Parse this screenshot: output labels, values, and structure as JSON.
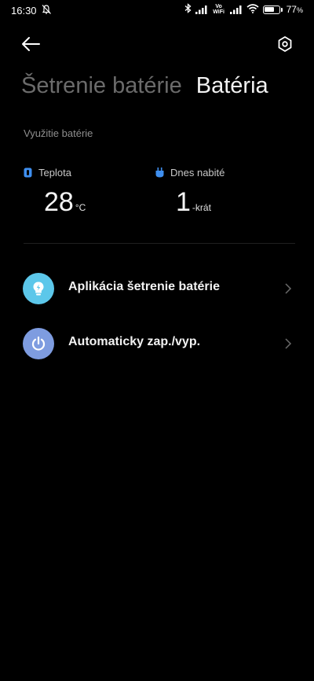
{
  "status_bar": {
    "time": "16:30",
    "volte_top": "Vo",
    "volte_bottom": "WiFi",
    "battery_percent": "77",
    "battery_unit": "%",
    "battery_level": 0.77
  },
  "tabs": [
    {
      "label": "Šetrenie batérie",
      "active": false
    },
    {
      "label": "Batéria",
      "active": true
    }
  ],
  "usage_section": {
    "label": "Využitie batérie"
  },
  "stats": {
    "temperature": {
      "label": "Teplota",
      "value": "28",
      "unit": "°C",
      "icon_color": "#3f8ff0"
    },
    "charged_today": {
      "label": "Dnes nabité",
      "value": "1",
      "unit": "-krát",
      "icon_color": "#3f8ff0"
    }
  },
  "rows": [
    {
      "label": "Aplikácia šetrenie batérie",
      "icon": "bulb-bolt-icon",
      "icon_color": "#5cc7ea"
    },
    {
      "label": "Automaticky zap./vyp.",
      "icon": "power-icon",
      "icon_color": "#7e9ce0"
    }
  ]
}
